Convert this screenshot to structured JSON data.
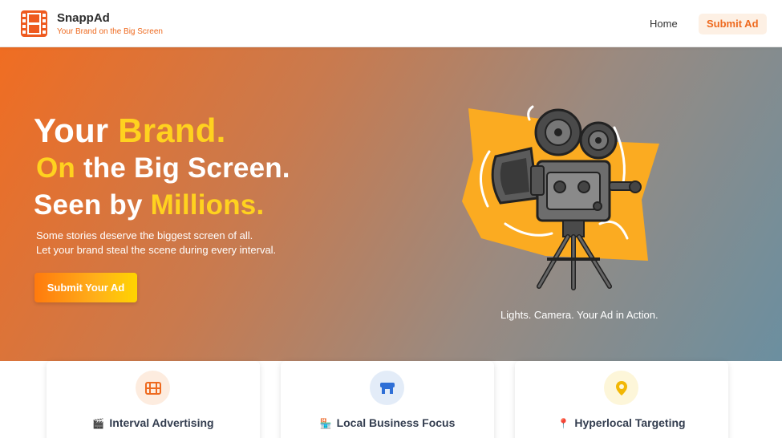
{
  "header": {
    "brand_name": "SnappAd",
    "brand_tagline": "Your Brand on the Big Screen",
    "nav": {
      "home": "Home",
      "submit_ad": "Submit Ad"
    }
  },
  "hero": {
    "line1": {
      "a": "Your ",
      "b": "Brand."
    },
    "line2": {
      "a": "On",
      "b": " the Big Screen."
    },
    "line3": {
      "a": "Seen by ",
      "b": "Millions."
    },
    "subtitle_1": "Some stories deserve the biggest screen of all.",
    "subtitle_2": "Let your brand steal the scene during every interval.",
    "cta_label": "Submit Your Ad",
    "illustration_icon": "film-camera-icon",
    "caption": "Lights. Camera. Your Ad in Action."
  },
  "features": [
    {
      "icon": "film-icon",
      "emoji": "🎬",
      "title": "Interval Advertising"
    },
    {
      "icon": "storefront-icon",
      "emoji": "🏪",
      "title": "Local Business Focus"
    },
    {
      "icon": "map-pin-icon",
      "emoji": "📍",
      "title": "Hyperlocal Targeting"
    }
  ],
  "colors": {
    "accent_orange": "#ee6a1f",
    "highlight_yellow": "#ffd21f",
    "gradient_start": "#f06d22",
    "gradient_end": "#6b8fa0"
  }
}
